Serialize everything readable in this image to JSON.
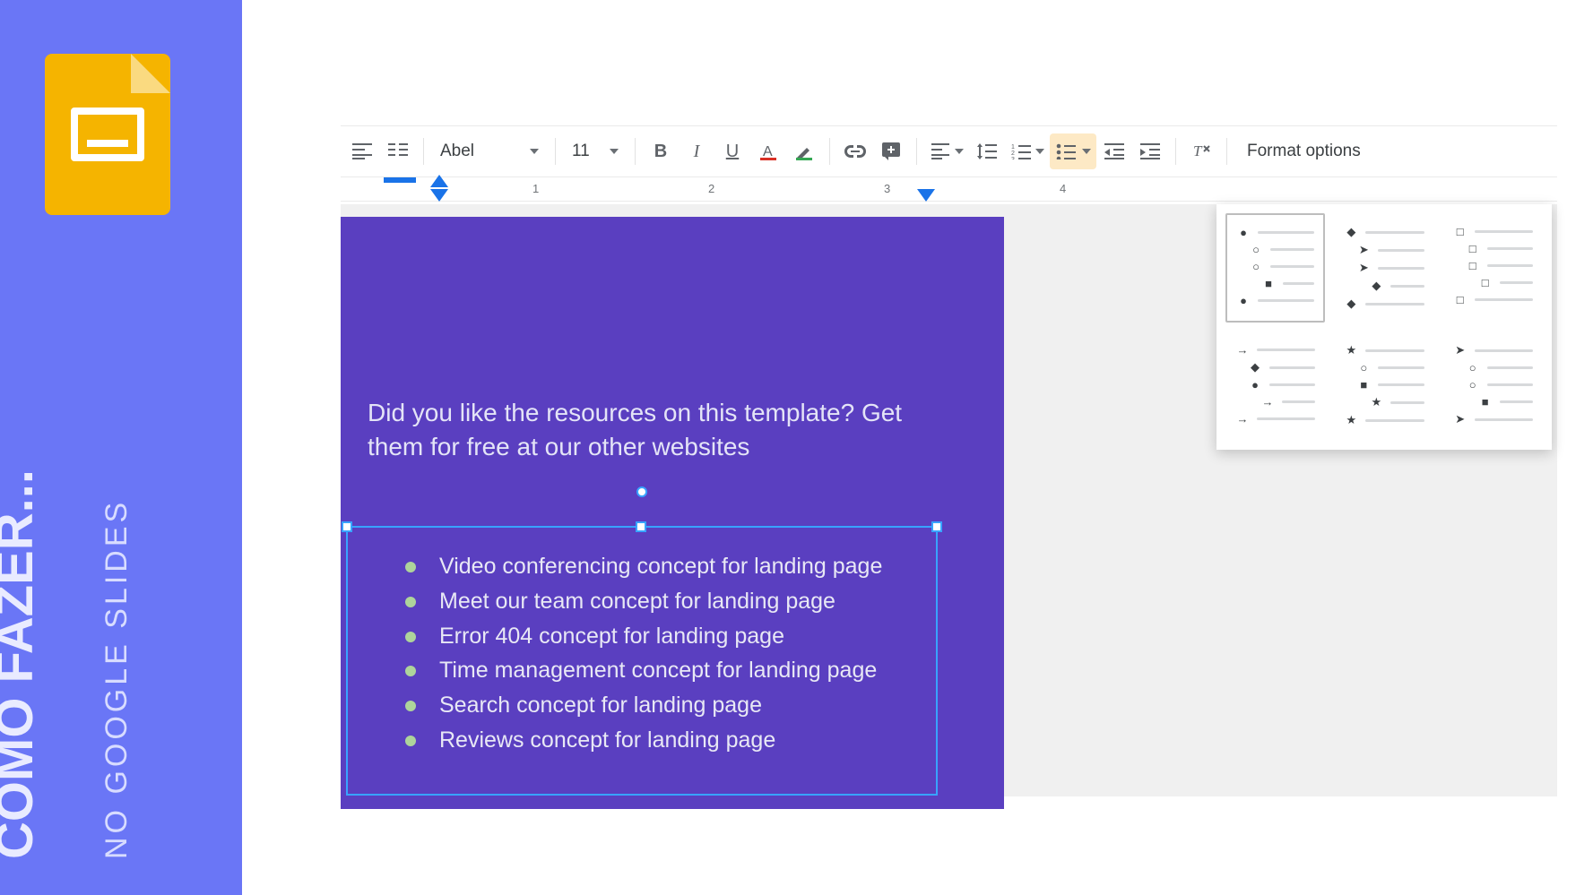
{
  "sidebar": {
    "title_line1": "COMO FAZER...",
    "title_line2": "NO GOOGLE SLIDES"
  },
  "toolbar": {
    "font_name": "Abel",
    "font_size": "11",
    "format_options": "Format options"
  },
  "ruler": {
    "marks": [
      "1",
      "2",
      "3",
      "4"
    ]
  },
  "slide": {
    "heading": "Did you like the resources on this template? Get them for free at our other websites",
    "bullets": [
      "Video conferencing concept for landing page",
      "Meet our team concept for landing page",
      "Error 404 concept for landing page",
      "Time management concept for landing page",
      "Search concept for landing page",
      "Reviews concept for landing page"
    ]
  },
  "bullet_presets": [
    {
      "glyphs": [
        "●",
        "○",
        "○",
        "■",
        "●"
      ],
      "selected": true
    },
    {
      "glyphs": [
        "◆",
        "➤",
        "➤",
        "◆",
        "◆"
      ],
      "selected": false
    },
    {
      "glyphs": [
        "□",
        "□",
        "□",
        "□",
        "□"
      ],
      "selected": false
    },
    {
      "glyphs": [
        "→",
        "◆",
        "●",
        "→",
        "→"
      ],
      "selected": false
    },
    {
      "glyphs": [
        "★",
        "○",
        "■",
        "★",
        "★"
      ],
      "selected": false
    },
    {
      "glyphs": [
        "➤",
        "○",
        "○",
        "■",
        "➤"
      ],
      "selected": false
    }
  ]
}
